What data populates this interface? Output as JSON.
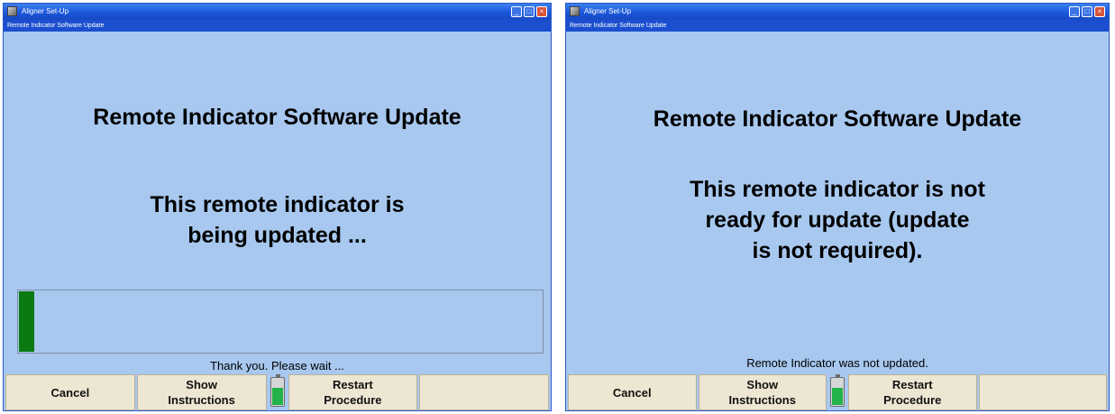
{
  "panels": [
    {
      "window_title": "Aligner Set-Up",
      "subtitle": "Remote Indicator Software Update",
      "heading": "Remote Indicator Software Update",
      "message_lines": [
        "This remote indicator is",
        "being updated ..."
      ],
      "progress_percent": 3,
      "status": "Thank you.  Please wait ...",
      "battery_level_percent": 60,
      "buttons": {
        "cancel": "Cancel",
        "show_instructions": "Show\nInstructions",
        "restart_procedure": "Restart\nProcedure",
        "empty": ""
      }
    },
    {
      "window_title": "Aligner Set-Up",
      "subtitle": "Remote Indicator Software Update",
      "heading": "Remote Indicator Software Update",
      "message_lines": [
        "This remote indicator is not",
        "ready for update (update",
        "is not required)."
      ],
      "status": "Remote Indicator was not updated.",
      "battery_level_percent": 60,
      "buttons": {
        "cancel": "Cancel",
        "show_instructions": "Show\nInstructions",
        "restart_procedure": "Restart\nProcedure",
        "empty": ""
      }
    }
  ],
  "colors": {
    "background": "#a8c8ef",
    "titlebar": "#1a55d8",
    "progress_fill": "#0c7a12",
    "battery_fill": "#22b34a",
    "button_face": "#ece6d2"
  }
}
